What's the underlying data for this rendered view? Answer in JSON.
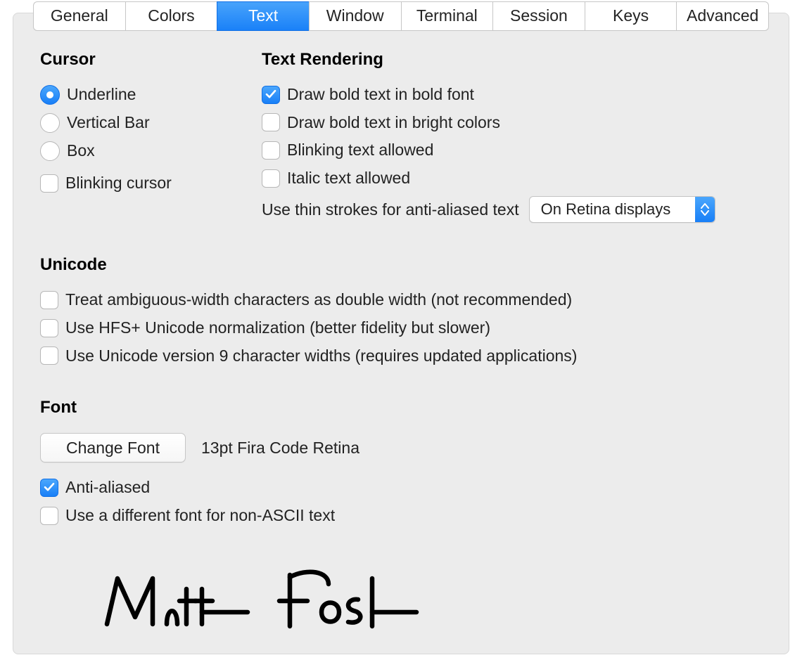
{
  "tabs": [
    "General",
    "Colors",
    "Text",
    "Window",
    "Terminal",
    "Session",
    "Keys",
    "Advanced"
  ],
  "active_tab_index": 2,
  "cursor": {
    "heading": "Cursor",
    "options": [
      "Underline",
      "Vertical Bar",
      "Box"
    ],
    "selected_index": 0,
    "blinking_label": "Blinking cursor",
    "blinking_checked": false
  },
  "text_rendering": {
    "heading": "Text Rendering",
    "items": [
      {
        "label": "Draw bold text in bold font",
        "checked": true
      },
      {
        "label": "Draw bold text in bright colors",
        "checked": false
      },
      {
        "label": "Blinking text allowed",
        "checked": false
      },
      {
        "label": "Italic text allowed",
        "checked": false
      }
    ],
    "thin_strokes_label": "Use thin strokes for anti-aliased text",
    "thin_strokes_value": "On Retina displays"
  },
  "unicode": {
    "heading": "Unicode",
    "items": [
      {
        "label": "Treat ambiguous-width characters as double width (not recommended)",
        "checked": false
      },
      {
        "label": "Use HFS+ Unicode normalization (better fidelity but slower)",
        "checked": false
      },
      {
        "label": "Use Unicode version 9 character widths (requires updated applications)",
        "checked": false
      }
    ]
  },
  "font": {
    "heading": "Font",
    "change_button": "Change Font",
    "current": "13pt Fira Code Retina",
    "anti_aliased_label": "Anti-aliased",
    "anti_aliased_checked": true,
    "non_ascii_label": "Use a different font for non-ASCII text",
    "non_ascii_checked": false
  },
  "colors": {
    "accent": "#1a81f8"
  }
}
